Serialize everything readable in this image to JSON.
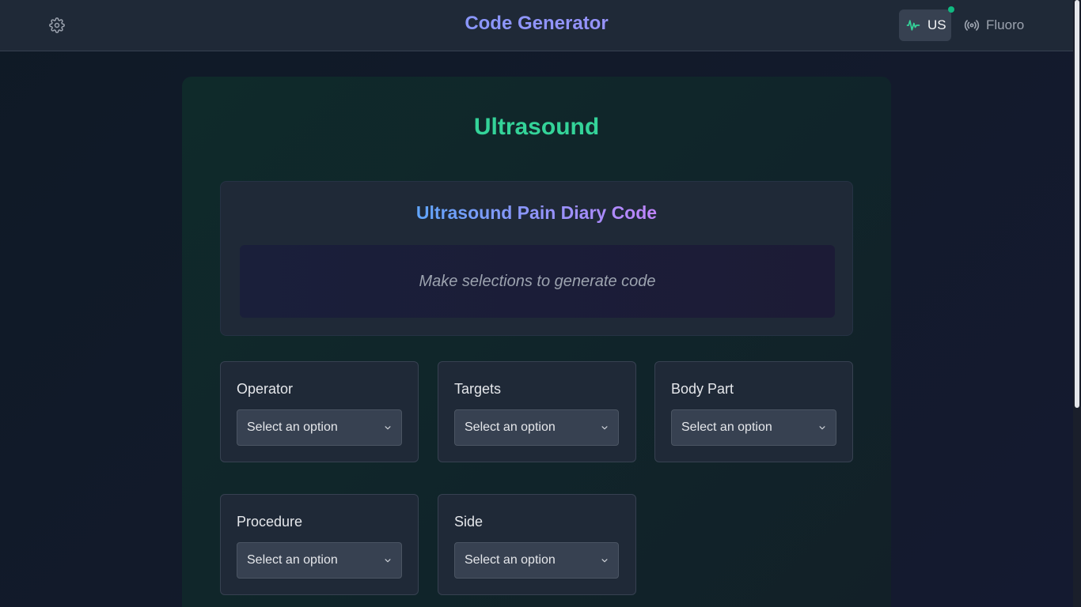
{
  "header": {
    "title": "Code Generator",
    "modes": [
      {
        "label": "US",
        "icon": "waveform-icon",
        "active": true
      },
      {
        "label": "Fluoro",
        "icon": "broadcast-icon",
        "active": false
      }
    ]
  },
  "section": {
    "title": "Ultrasound",
    "code_card": {
      "title": "Ultrasound Pain Diary Code",
      "placeholder": "Make selections to generate code"
    },
    "fields": [
      {
        "label": "Operator",
        "value": "Select an option"
      },
      {
        "label": "Targets",
        "value": "Select an option"
      },
      {
        "label": "Body Part",
        "value": "Select an option"
      },
      {
        "label": "Procedure",
        "value": "Select an option"
      },
      {
        "label": "Side",
        "value": "Select an option"
      }
    ]
  },
  "colors": {
    "accent_green": "#34d399",
    "gradient_start": "#60a5fa",
    "gradient_end": "#c084fc",
    "status_dot": "#10b981"
  }
}
